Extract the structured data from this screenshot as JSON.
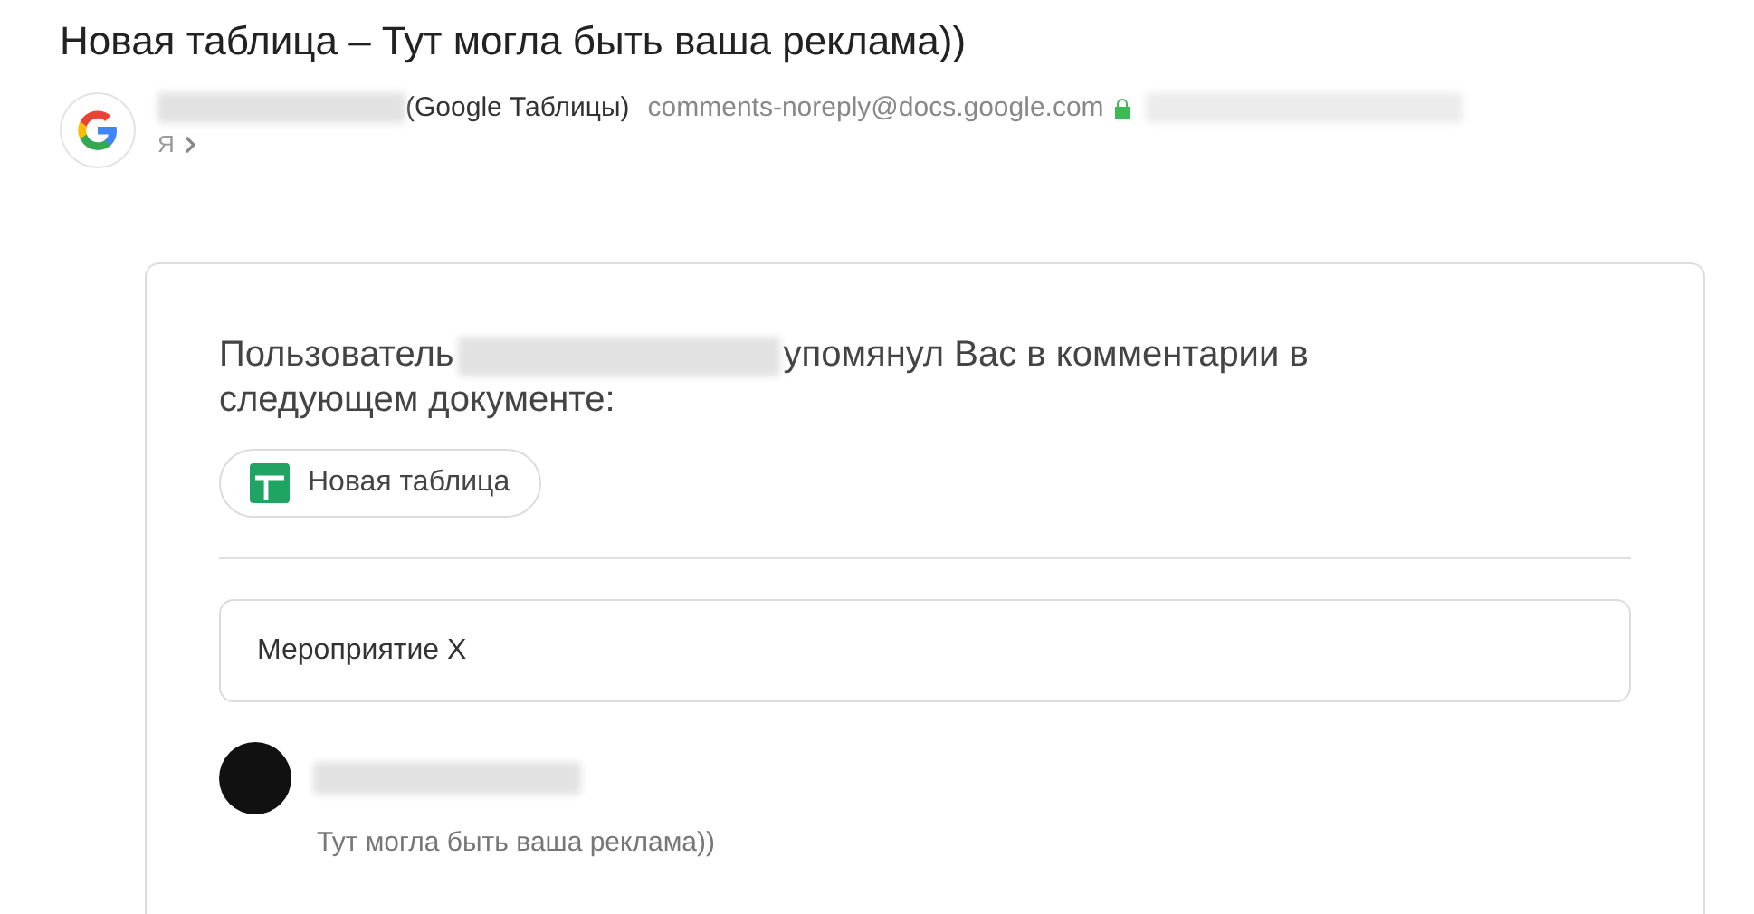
{
  "subject": "Новая таблица – Тут могла быть ваша реклама))",
  "sender": {
    "name_suffix": "(Google Таблицы)",
    "email": "comments-noreply@docs.google.com",
    "recipient": "Я"
  },
  "message": {
    "intro_before": "Пользователь",
    "intro_after": "упомянул Вас в комментарии в следующем документе:",
    "document_chip": "Новая таблица",
    "comment_box": "Мероприятие X",
    "comment_text": "Тут могла быть ваша реклама))"
  }
}
